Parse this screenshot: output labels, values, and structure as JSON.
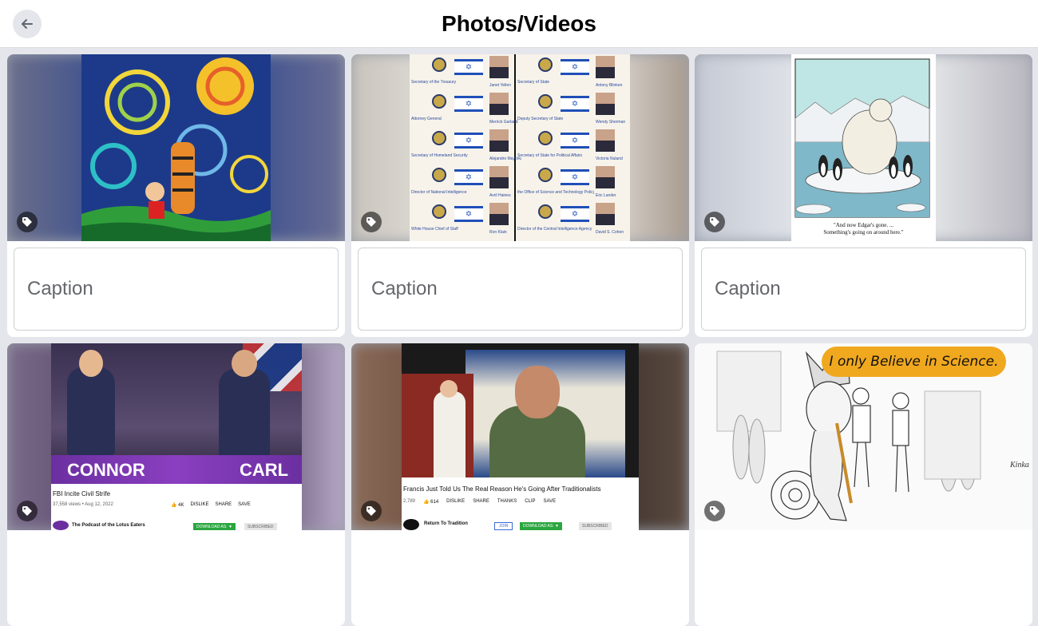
{
  "header": {
    "title": "Photos/Videos"
  },
  "cards": [
    {
      "caption_placeholder": "Caption"
    },
    {
      "caption_placeholder": "Caption",
      "officials": [
        {
          "dept": "Secretary of the Treasury",
          "name": "Janet Yellen"
        },
        {
          "dept": "Secretary of State",
          "name": "Antony Blinken"
        },
        {
          "dept": "Attorney General",
          "name": "Merrick Garland"
        },
        {
          "dept": "Deputy Secretary of State",
          "name": "Wendy Sherman"
        },
        {
          "dept": "Secretary of Homeland Security",
          "name": "Alejandro Mayorkas"
        },
        {
          "dept": "Secretary of State for Political Affairs",
          "name": "Victoria Nuland"
        },
        {
          "dept": "Director of National Intelligence",
          "name": "Avril Haines"
        },
        {
          "dept": "the Office of Science and Technology Policy",
          "name": "Eric Lander"
        },
        {
          "dept": "White House Chief of Staff",
          "name": "Ron Klain"
        },
        {
          "dept": "Director of the Central Intelligence Agency",
          "name": "David S. Cohen"
        }
      ]
    },
    {
      "caption_placeholder": "Caption",
      "cartoon_caption_1": "\"And now Edgar's gone. ...",
      "cartoon_caption_2": "Something's going on around here.\""
    },
    {
      "left_name": "CONNOR",
      "right_name": "CARL",
      "video_title": "FBI Incite Civil Strife",
      "views": "37,558 views • Aug 12, 2022",
      "likes": "4K",
      "dislike": "DISLIKE",
      "share": "SHARE",
      "save": "SAVE",
      "channel": "The Podcast of the Lotus Eaters",
      "download": "DOWNLOAD AS: ▼",
      "subscribed": "SUBSCRIBED"
    },
    {
      "video_title": "Francis Just Told Us The Real Reason He's Going After Traditionalists",
      "views": "2,789",
      "likes": "614",
      "dislike": "DISLIKE",
      "share": "SHARE",
      "thanks": "THANKS",
      "clip": "CLIP",
      "save": "SAVE",
      "channel": "Return To Tradition",
      "join": "JOIN",
      "download": "DOWNLOAD AS: ▼",
      "subscribed": "SUBSCRIBED"
    },
    {
      "speech": "I only Believe in Science."
    }
  ],
  "colors": {
    "accent": "#1877f2",
    "yt_green": "#2ba640",
    "purple": "#6b2fa0"
  }
}
